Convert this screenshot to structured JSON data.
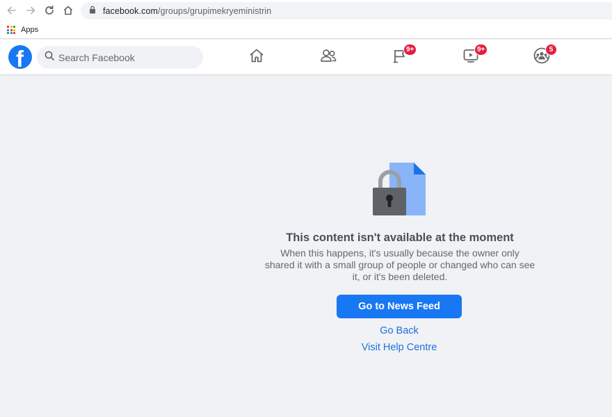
{
  "browser": {
    "url_host": "facebook.com",
    "url_path": "/groups/grupimekryeministrin",
    "bookmarks": {
      "apps_label": "Apps"
    },
    "apps_colors": [
      "#ea4335",
      "#fbbc04",
      "#34a853",
      "#4285f4",
      "#ea4335",
      "#fbbc04",
      "#34a853",
      "#4285f4",
      "#ea4335"
    ]
  },
  "fb_header": {
    "logo_letter": "f",
    "search_placeholder": "Search Facebook",
    "nav": [
      {
        "name": "home",
        "icon": "home-icon",
        "badge": ""
      },
      {
        "name": "friends",
        "icon": "friends-icon",
        "badge": ""
      },
      {
        "name": "pages",
        "icon": "flag-icon",
        "badge": "9+"
      },
      {
        "name": "watch",
        "icon": "video-icon",
        "badge": "9+"
      },
      {
        "name": "groups",
        "icon": "groups-icon",
        "badge": "5"
      }
    ]
  },
  "message": {
    "title": "This content isn't available at the moment",
    "description": "When this happens, it's usually because the owner only shared it with a small group of people or changed who can see it, or it's been deleted.",
    "primary_button": "Go to News Feed",
    "back_link": "Go Back",
    "help_link": "Visit Help Centre"
  },
  "colors": {
    "brand": "#1877f2",
    "badge": "#e41e3f",
    "link": "#216fdb",
    "background": "#f0f2f5"
  }
}
